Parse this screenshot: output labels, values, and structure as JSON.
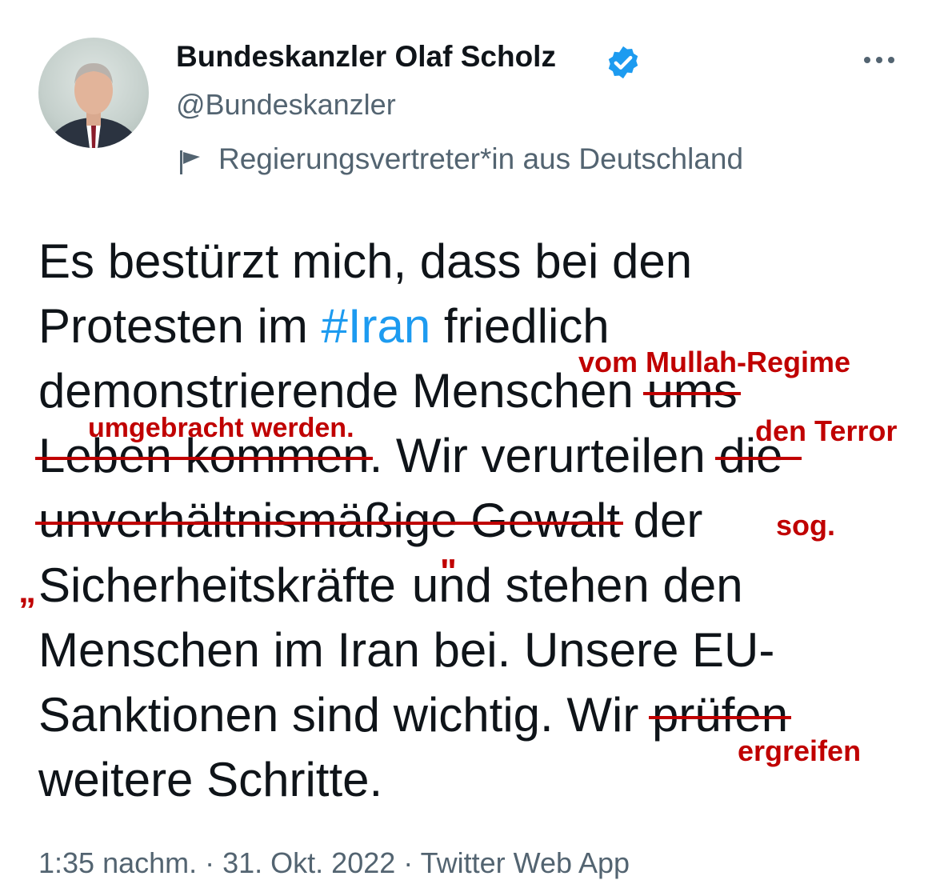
{
  "author": {
    "name": "Bundeskanzler Olaf Scholz",
    "handle": "@Bundeskanzler",
    "verified_icon": "verified-badge-icon",
    "badge_color": "#1d9bf0",
    "gov_label": "Regierungsvertreter*in aus Deutschland"
  },
  "tweet": {
    "line1": "Es bestürzt mich, dass bei den",
    "line2_pre": "Protesten im ",
    "hashtag": "#Iran",
    "line2_post": " friedlich",
    "line3_pre": "demonstrierende Menschen ",
    "line3_struck": "ums",
    "line4_struck": "Leben kommen",
    "line4_mid": ". Wir verurteilen ",
    "line4_struck2": "die",
    "line5_struck": "unverhältnismäßige Gewalt",
    "line5_post": " der",
    "line6_pre": "Sicherheitskräfte",
    "line6_post": "und stehen den",
    "line7": "Menschen im Iran bei. Unsere EU-",
    "line8_pre": "Sanktionen sind wichtig. Wir ",
    "line8_struck": "prüfen",
    "line9": "weitere Schritte."
  },
  "annotations": {
    "color": "#c00000",
    "vom_mullah": "vom Mullah-Regime",
    "umgebracht": "umgebracht werden.",
    "den_terror": "den Terror",
    "sog": "sog.",
    "open_quote": "„",
    "close_quote": "\"",
    "ergreifen": "ergreifen"
  },
  "meta": {
    "text": "1:35 nachm. · 31. Okt. 2022 · Twitter Web App"
  }
}
